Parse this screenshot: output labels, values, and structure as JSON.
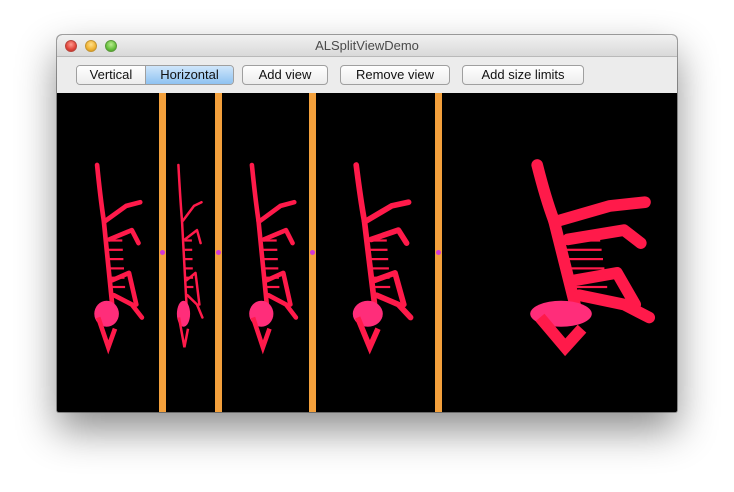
{
  "window": {
    "title": "ALSplitViewDemo"
  },
  "toolbar": {
    "orientation": {
      "vertical_label": "Vertical",
      "horizontal_label": "Horizontal",
      "selected": "Horizontal"
    },
    "add_view_label": "Add view",
    "remove_view_label": "Remove view",
    "add_size_limits_label": "Add size limits"
  },
  "split_view": {
    "pane_count": 5,
    "divider_color": "#f3a03c",
    "handle_color": "#d238d8",
    "background_color": "#000000",
    "image_colors": [
      "#ff1a4a",
      "#ff2d7a"
    ]
  }
}
